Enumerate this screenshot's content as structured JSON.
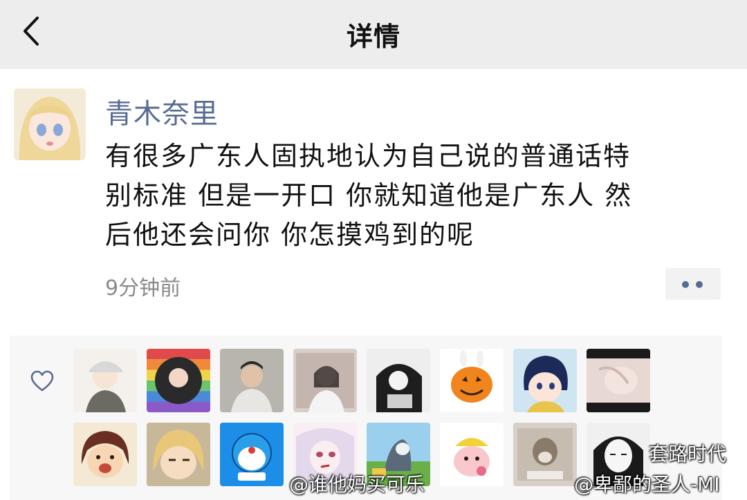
{
  "header": {
    "title": "详情"
  },
  "post": {
    "username": "青木奈里",
    "content_lines": [
      "有很多广东人固执地认为自己说的普通话特",
      "别标准 但是一开口 你就知道他是广东人 然",
      "后他还会问你 你怎摸鸡到的呢"
    ],
    "time": "9分钟前"
  },
  "likes": {
    "count_avatars": 16
  },
  "watermarks": {
    "left": "@谁他妈买可乐",
    "right": "@卑鄙的圣人-MI",
    "brand": "套路时代"
  },
  "colors": {
    "header_bg": "#ededed",
    "name_blue": "#576b95",
    "text": "#111111",
    "time_gray": "#8a8a8a",
    "likes_bg": "#f7f7f7"
  }
}
